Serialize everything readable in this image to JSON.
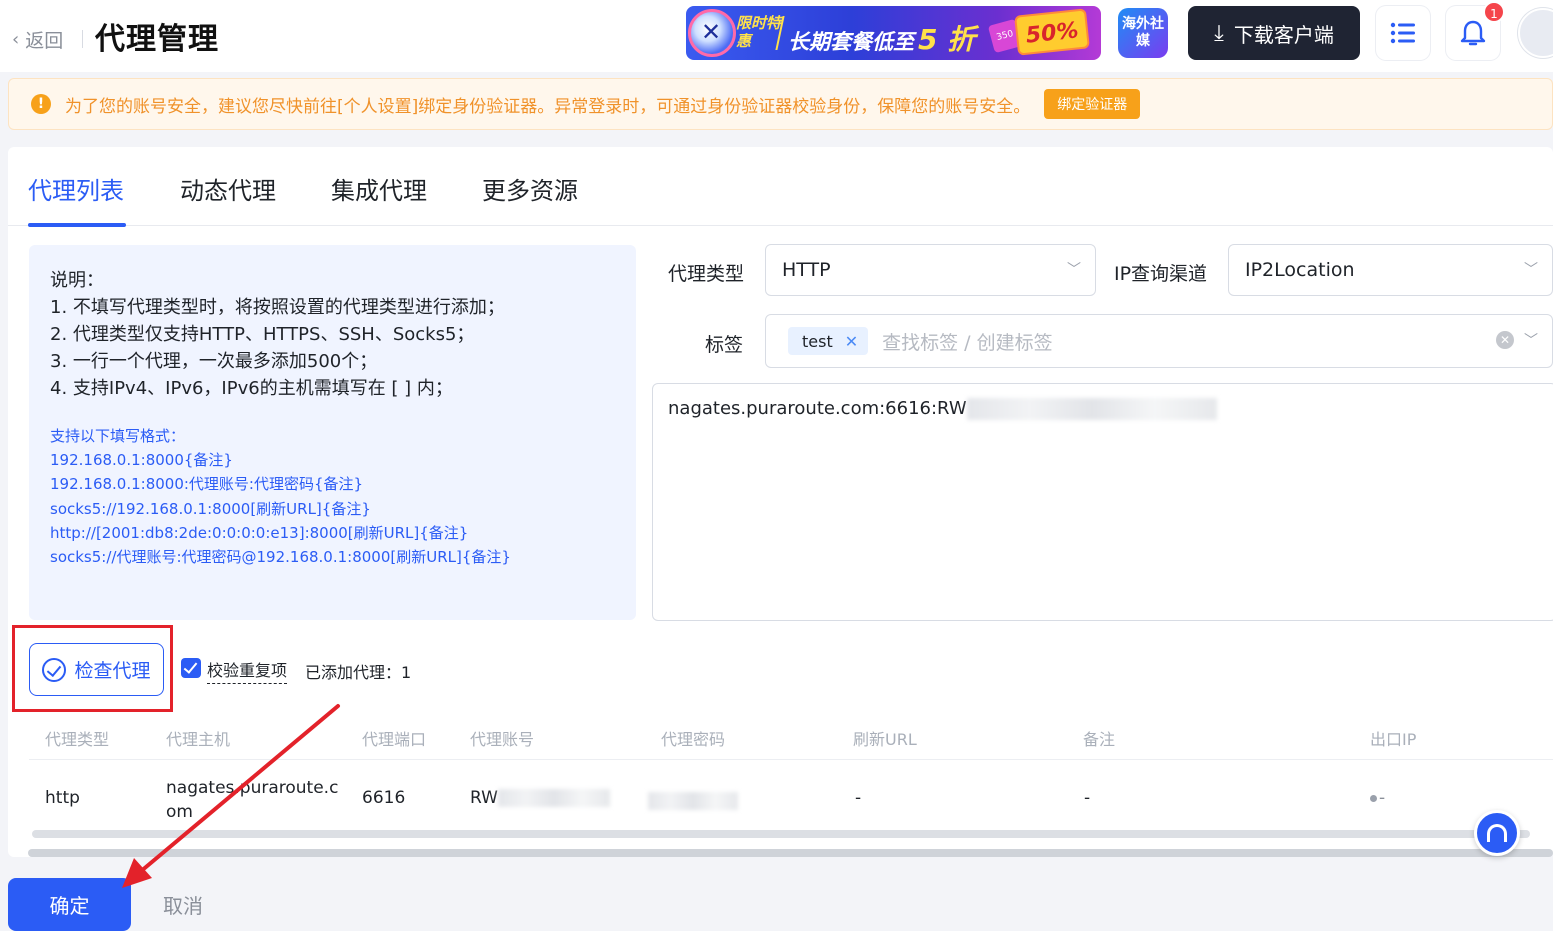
{
  "header": {
    "back_label": "返回",
    "title": "代理管理",
    "promo": {
      "tag": "限时特惠",
      "text": "长期套餐低至",
      "highlight": "5 折",
      "badge": "50%",
      "ticket": "350"
    },
    "social_label": "海外社媒",
    "download_label": "下载客户端",
    "notification_count": "1"
  },
  "alert": {
    "text": "为了您的账号安全，建议您尽快前往[个人设置]绑定身份验证器。异常登录时，可通过身份验证器校验身份，保障您的账号安全。",
    "button": "绑定验证器"
  },
  "tabs": [
    {
      "label": "代理列表",
      "active": true
    },
    {
      "label": "动态代理",
      "active": false
    },
    {
      "label": "集成代理",
      "active": false
    },
    {
      "label": "更多资源",
      "active": false
    }
  ],
  "info": {
    "desc": [
      "说明：",
      "1. 不填写代理类型时，将按照设置的代理类型进行添加；",
      "2. 代理类型仅支持HTTP、HTTPS、SSH、Socks5；",
      "3. 一行一个代理，一次最多添加500个；",
      "4. 支持IPv4、IPv6，IPv6的主机需填写在 [ ] 内；"
    ],
    "formats": [
      "支持以下填写格式：",
      "192.168.0.1:8000{备注}",
      "192.168.0.1:8000:代理账号:代理密码{备注}",
      "socks5://192.168.0.1:8000[刷新URL]{备注}",
      "http://[2001:db8:2de:0:0:0:0:e13]:8000[刷新URL]{备注}",
      "socks5://代理账号:代理密码@192.168.0.1:8000[刷新URL]{备注}"
    ]
  },
  "form": {
    "proxy_type_label": "代理类型",
    "proxy_type_value": "HTTP",
    "ip_channel_label": "IP查询渠道",
    "ip_channel_value": "IP2Location",
    "tags_label": "标签",
    "tag_chip": "test",
    "tag_placeholder": "查找标签 / 创建标签",
    "textarea_value": "nagates.puraroute.com:6616:RW"
  },
  "actions": {
    "check_proxy": "检查代理",
    "verify_duplicates": "校验重复项",
    "added_count": "已添加代理：1"
  },
  "table": {
    "columns": [
      "代理类型",
      "代理主机",
      "代理端口",
      "代理账号",
      "代理密码",
      "刷新URL",
      "备注",
      "出口IP"
    ],
    "rows": [
      {
        "type": "http",
        "host_line1": "nagates.puraroute.c",
        "host_line2": "om",
        "port": "6616",
        "account": "RW",
        "refresh": "-",
        "note": "-",
        "exit_ip": "-"
      }
    ]
  },
  "footer": {
    "confirm": "确定",
    "cancel": "取消"
  },
  "colors": {
    "primary": "#2b5cf5",
    "warning": "#f7a11a",
    "annotation_red": "#e3222a"
  }
}
